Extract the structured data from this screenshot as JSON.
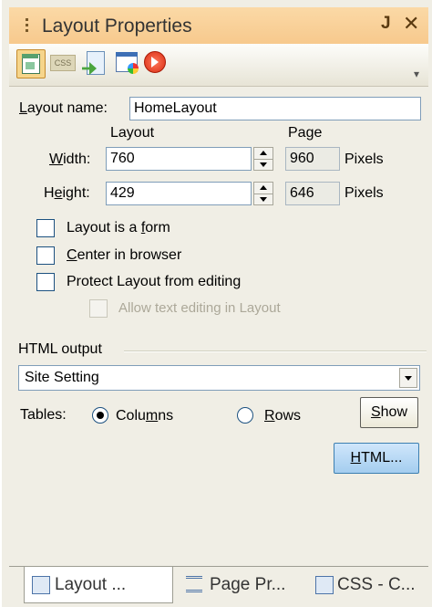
{
  "title": "Layout Properties",
  "title_buttons": {
    "pin": "Ͱ",
    "close": "✕"
  },
  "toolbar": {
    "items": [
      "layout-properties-icon",
      "css-icon",
      "export-icon",
      "page-style-icon",
      "preview-icon"
    ],
    "css_label": "CSS"
  },
  "layout_name": {
    "label": "Layout name:",
    "value": "HomeLayout"
  },
  "columns": {
    "layout": "Layout",
    "page": "Page"
  },
  "width": {
    "label": "Width:",
    "layout_value": "760",
    "page_value": "960",
    "unit": "Pixels"
  },
  "height": {
    "label": "Height:",
    "layout_value": "429",
    "page_value": "646",
    "unit": "Pixels"
  },
  "checkboxes": {
    "is_form": "Layout is a form",
    "center": "Center in browser",
    "protect": "Protect Layout from editing",
    "allow_text": "Allow text editing in Layout"
  },
  "html_output": {
    "group_label": "HTML output",
    "select_value": "Site Setting",
    "tables_label": "Tables:",
    "columns_option": "Columns",
    "rows_option": "Rows",
    "selected": "Columns",
    "show_button": "Show",
    "html_button": "HTML..."
  },
  "tabs": [
    {
      "label": "Layout ...",
      "active": true
    },
    {
      "label": "Page Pr...",
      "active": false
    },
    {
      "label": "CSS - C...",
      "active": false
    }
  ],
  "colors": {
    "title_bar": "#f7c98d",
    "panel_bg": "#f0eee5",
    "default_button": "#a4cdef"
  }
}
